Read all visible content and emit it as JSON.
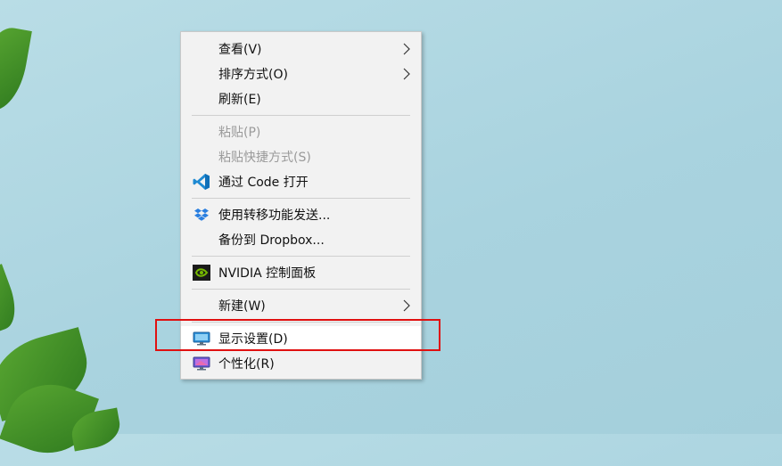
{
  "context_menu": {
    "items": [
      {
        "label": "查看(V)",
        "submenu": true
      },
      {
        "label": "排序方式(O)",
        "submenu": true
      },
      {
        "label": "刷新(E)"
      },
      {
        "label": "粘贴(P)",
        "disabled": true
      },
      {
        "label": "粘贴快捷方式(S)",
        "disabled": true
      },
      {
        "label": "通过 Code 打开",
        "icon": "vscode-icon"
      },
      {
        "label": "使用转移功能发送...",
        "icon": "dropbox-icon"
      },
      {
        "label": "备份到 Dropbox..."
      },
      {
        "label": "NVIDIA 控制面板",
        "icon": "nvidia-icon"
      },
      {
        "label": "新建(W)",
        "submenu": true
      },
      {
        "label": "显示设置(D)",
        "icon": "display-settings-icon",
        "highlighted": true
      },
      {
        "label": "个性化(R)",
        "icon": "personalize-icon"
      }
    ]
  },
  "colors": {
    "highlight_box": "#e01010",
    "menu_background": "#f2f2f2",
    "desktop_background": "#aad4df"
  }
}
